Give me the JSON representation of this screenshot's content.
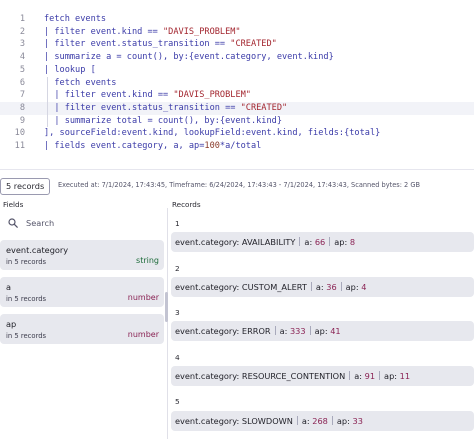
{
  "editor": {
    "lines": [
      {
        "n": "1",
        "tokens": [
          {
            "t": "fetch events",
            "c": "plain"
          }
        ]
      },
      {
        "n": "2",
        "tokens": [
          {
            "t": "| filter event.kind == ",
            "c": "plain"
          },
          {
            "t": "\"DAVIS_PROBLEM\"",
            "c": "str"
          }
        ]
      },
      {
        "n": "3",
        "tokens": [
          {
            "t": "| filter event.status_transition == ",
            "c": "plain"
          },
          {
            "t": "\"CREATED\"",
            "c": "str"
          }
        ]
      },
      {
        "n": "4",
        "tokens": [
          {
            "t": "| summarize a = count(), by:{event.category, event.kind}",
            "c": "plain"
          }
        ]
      },
      {
        "n": "5",
        "tokens": [
          {
            "t": "| lookup [",
            "c": "plain"
          }
        ]
      },
      {
        "n": "6",
        "tokens": [
          {
            "t": "  fetch events",
            "c": "plain"
          }
        ]
      },
      {
        "n": "7",
        "tokens": [
          {
            "t": "  | filter event.kind == ",
            "c": "plain"
          },
          {
            "t": "\"DAVIS_PROBLEM\"",
            "c": "str"
          }
        ]
      },
      {
        "n": "8",
        "tokens": [
          {
            "t": "  | filter event.status_transition == ",
            "c": "plain"
          },
          {
            "t": "\"CREATED\"",
            "c": "str"
          }
        ]
      },
      {
        "n": "9",
        "tokens": [
          {
            "t": "  | summarize total = count(), by:{event.kind}",
            "c": "plain"
          }
        ]
      },
      {
        "n": "10",
        "tokens": [
          {
            "t": "], sourceField:event.kind, lookupField:event.kind, fields:{total}",
            "c": "plain"
          }
        ]
      },
      {
        "n": "11",
        "tokens": [
          {
            "t": "| fields event.category, a, ap=",
            "c": "plain"
          },
          {
            "t": "100",
            "c": "num"
          },
          {
            "t": "*a/total",
            "c": "plain"
          }
        ]
      }
    ],
    "active_line": 8
  },
  "status": {
    "records_button": "5 records",
    "execution_info": "Executed at: 7/1/2024, 17:43:45, Timeframe: 6/24/2024, 17:43:43 - 7/1/2024, 17:43:43, Scanned bytes: 2 GB"
  },
  "fields_panel": {
    "title": "Fields",
    "search_placeholder": "Search",
    "items": [
      {
        "name": "event.category",
        "count": "in 5 records",
        "type": "string"
      },
      {
        "name": "a",
        "count": "in 5 records",
        "type": "number"
      },
      {
        "name": "ap",
        "count": "in 5 records",
        "type": "number"
      }
    ]
  },
  "records_panel": {
    "title": "Records",
    "items": [
      {
        "index": "1",
        "category_key": "event.category:",
        "category": "AVAILABILITY",
        "a_key": "a:",
        "a": "66",
        "ap_key": "ap:",
        "ap": "8"
      },
      {
        "index": "2",
        "category_key": "event.category:",
        "category": "CUSTOM_ALERT",
        "a_key": "a:",
        "a": "36",
        "ap_key": "ap:",
        "ap": "4"
      },
      {
        "index": "3",
        "category_key": "event.category:",
        "category": "ERROR",
        "a_key": "a:",
        "a": "333",
        "ap_key": "ap:",
        "ap": "41"
      },
      {
        "index": "4",
        "category_key": "event.category:",
        "category": "RESOURCE_CONTENTION",
        "a_key": "a:",
        "a": "91",
        "ap_key": "ap:",
        "ap": "11"
      },
      {
        "index": "5",
        "category_key": "event.category:",
        "category": "SLOWDOWN",
        "a_key": "a:",
        "a": "268",
        "ap_key": "ap:",
        "ap": "33"
      }
    ]
  },
  "colors": {
    "keyword": "#3b3ba8",
    "string": "#a3262f",
    "number_value": "#8a2354",
    "type_string": "#1d6b3a",
    "card_bg": "#e7e8ee"
  },
  "icons": {
    "search": "search-icon"
  }
}
